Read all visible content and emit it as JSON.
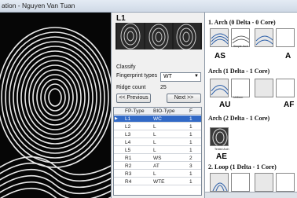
{
  "window": {
    "title": "ation - Nguyen Van Tuan"
  },
  "panel": {
    "heading": "L1",
    "classify_label": "Classify",
    "fp_types_label": "Fingerprint types",
    "fp_types_value": "WT",
    "ridge_count_label": "Ridge count",
    "ridge_count_value": "25",
    "prev_button": "<< Previous",
    "next_button": "Next >>"
  },
  "table": {
    "headers": [
      "FP-Type",
      "BIO-Type",
      "F"
    ],
    "rows": [
      {
        "fp": "L1",
        "bio": "WC",
        "f": "1"
      },
      {
        "fp": "L2",
        "bio": "L",
        "f": "1"
      },
      {
        "fp": "L3",
        "bio": "L",
        "f": "1"
      },
      {
        "fp": "L4",
        "bio": "L",
        "f": "1"
      },
      {
        "fp": "L5",
        "bio": "L",
        "f": "1"
      },
      {
        "fp": "R1",
        "bio": "WS",
        "f": "2"
      },
      {
        "fp": "R2",
        "bio": "AT",
        "f": "3"
      },
      {
        "fp": "R3",
        "bio": "L",
        "f": "1"
      },
      {
        "fp": "R4",
        "bio": "WTE",
        "f": "1"
      }
    ],
    "selected_index": 0
  },
  "reference": {
    "sections": [
      {
        "title": "1. Arch (0 Delta - 0 Core)",
        "code": "AS",
        "code2": "A"
      },
      {
        "title": "Arch (1 Delta - 1 Core)",
        "code": "AU",
        "code2": "AF"
      },
      {
        "title": "Arch (2 Delta - 1 Core)",
        "code": "AE",
        "code2": ""
      },
      {
        "title": "2. Loop (1 Delta - 1 Core)",
        "code": "",
        "code2": ""
      }
    ],
    "captions": [
      "Simple Arch",
      "Uniform",
      "Tented Arch"
    ]
  }
}
